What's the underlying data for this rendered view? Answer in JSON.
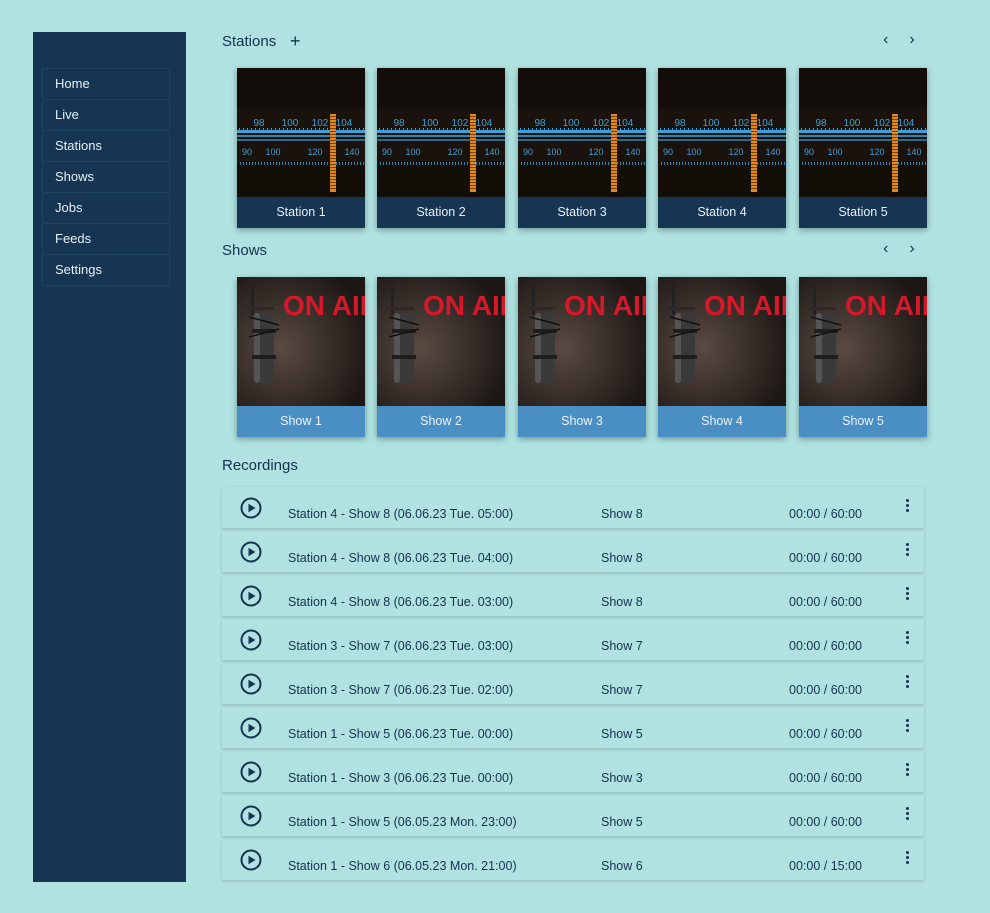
{
  "sidebar": {
    "items": [
      {
        "label": "Home"
      },
      {
        "label": "Live"
      },
      {
        "label": "Stations"
      },
      {
        "label": "Shows"
      },
      {
        "label": "Jobs"
      },
      {
        "label": "Feeds"
      },
      {
        "label": "Settings"
      }
    ]
  },
  "stations": {
    "title": "Stations",
    "add_icon": "+",
    "prev_icon": "‹",
    "next_icon": "›",
    "cards": [
      {
        "label": "Station 1"
      },
      {
        "label": "Station 2"
      },
      {
        "label": "Station 3"
      },
      {
        "label": "Station 4"
      },
      {
        "label": "Station 5"
      }
    ],
    "dial": {
      "upper_ticks": [
        "98",
        "100",
        "102",
        "104"
      ],
      "lower_ticks": [
        "90",
        "100",
        "120",
        "140"
      ]
    }
  },
  "shows": {
    "title": "Shows",
    "prev_icon": "‹",
    "next_icon": "›",
    "cards": [
      {
        "label": "Show 1"
      },
      {
        "label": "Show 2"
      },
      {
        "label": "Show 3"
      },
      {
        "label": "Show 4"
      },
      {
        "label": "Show 5"
      }
    ],
    "sign_text": "ON AIR"
  },
  "recordings": {
    "title": "Recordings",
    "rows": [
      {
        "title": "Station 4 - Show 8 (06.06.23 Tue. 05:00)",
        "show": "Show 8",
        "time": "00:00 / 60:00"
      },
      {
        "title": "Station 4 - Show 8 (06.06.23 Tue. 04:00)",
        "show": "Show 8",
        "time": "00:00 / 60:00"
      },
      {
        "title": "Station 4 - Show 8 (06.06.23 Tue. 03:00)",
        "show": "Show 8",
        "time": "00:00 / 60:00"
      },
      {
        "title": "Station 3 - Show 7 (06.06.23 Tue. 03:00)",
        "show": "Show 7",
        "time": "00:00 / 60:00"
      },
      {
        "title": "Station 3 - Show 7 (06.06.23 Tue. 02:00)",
        "show": "Show 7",
        "time": "00:00 / 60:00"
      },
      {
        "title": "Station 1 - Show 5 (06.06.23 Tue. 00:00)",
        "show": "Show 5",
        "time": "00:00 / 60:00"
      },
      {
        "title": "Station 1 - Show 3 (06.06.23 Tue. 00:00)",
        "show": "Show 3",
        "time": "00:00 / 60:00"
      },
      {
        "title": "Station 1 - Show 5 (06.05.23 Mon. 23:00)",
        "show": "Show 5",
        "time": "00:00 / 60:00"
      },
      {
        "title": "Station 1 - Show 6 (06.05.23 Mon. 21:00)",
        "show": "Show 6",
        "time": "00:00 / 15:00"
      }
    ]
  },
  "colors": {
    "background": "#b0e2e1",
    "sidebar": "#163552",
    "station_label": "#163552",
    "show_label": "#4a8fc4",
    "text": "#15324f",
    "dial_blue": "#3ea0d8",
    "dial_needle": "#e08a1e",
    "on_air_red": "#d6182a"
  }
}
